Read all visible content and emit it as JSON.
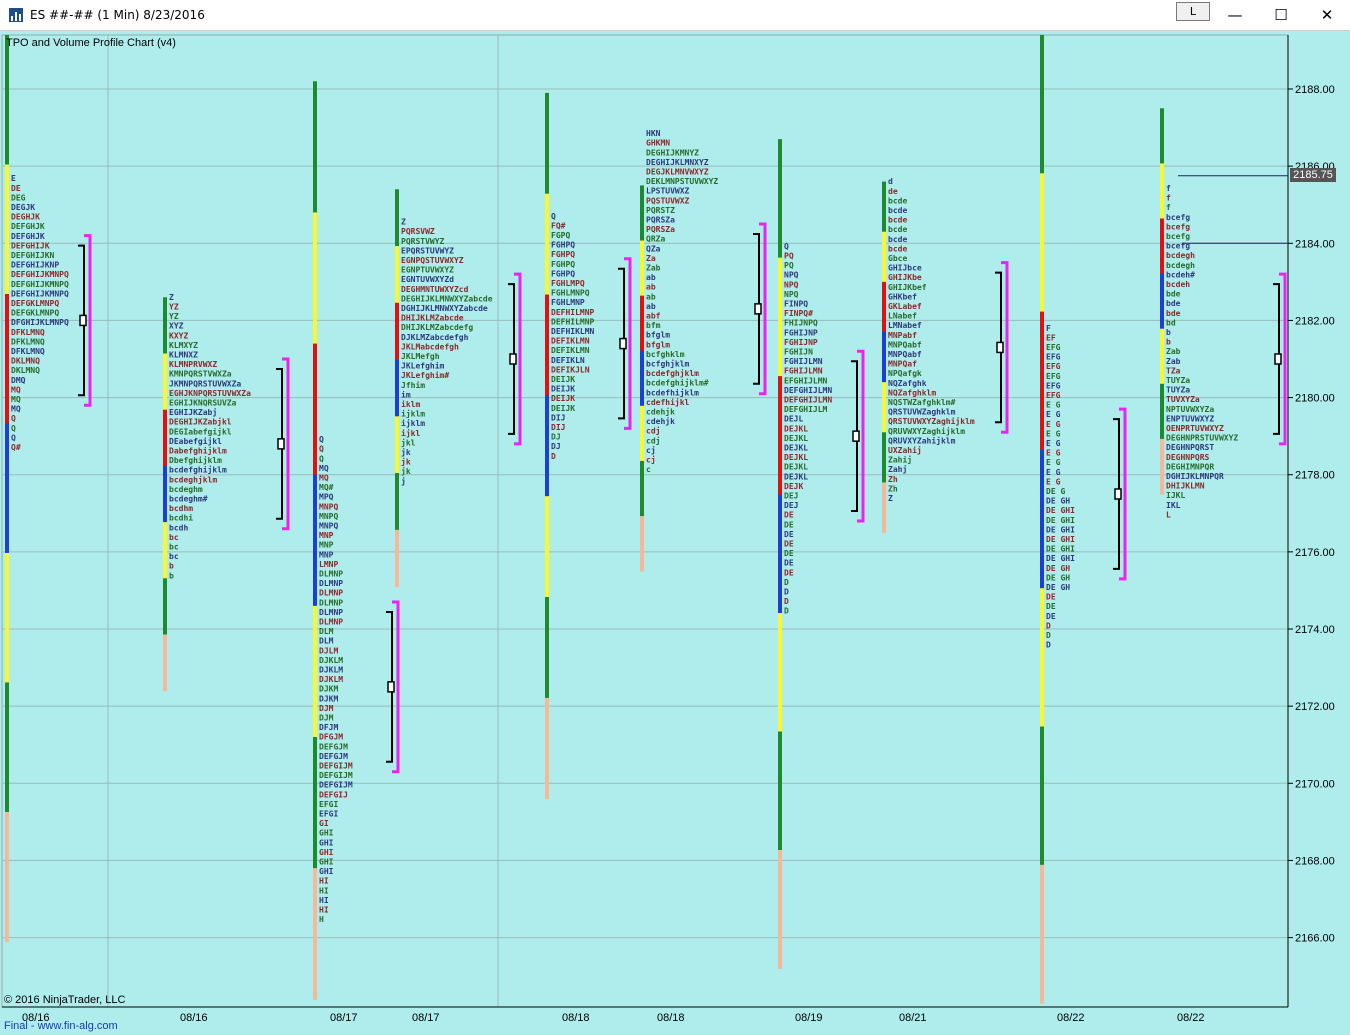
{
  "window": {
    "title": "ES ##-## (1 Min)  8/23/2016",
    "link_label": "L",
    "minimize_glyph": "—",
    "maximize_glyph": "☐",
    "close_glyph": "✕"
  },
  "chart": {
    "title": "TPO and Volume Profile Chart (v4)",
    "copyright": "© 2016 NinjaTrader, LLC",
    "footer_link": "Final - www.fin-alg.com",
    "last_price_label": "2185.75",
    "background_color": "#afecec"
  },
  "chart_data": {
    "type": "tpo-profile",
    "title": "TPO and Volume Profile Chart (v4)",
    "y_ticks": [
      "2188.00",
      "2186.00",
      "2184.00",
      "2182.00",
      "2180.00",
      "2178.00",
      "2176.00",
      "2174.00",
      "2172.00",
      "2170.00",
      "2168.00",
      "2166.00"
    ],
    "y_range": [
      2164.2,
      2189.4
    ],
    "last_price": 2185.75,
    "x_labels": [
      "08/16",
      "08/16",
      "08/17",
      "08/17",
      "08/18",
      "08/18",
      "08/19",
      "08/21",
      "08/22",
      "08/22"
    ],
    "grid": true,
    "profiles": [
      {
        "session": "08/16",
        "high": 2189.4,
        "low": 2165.9,
        "poc": 2182.0,
        "letters": [
          "E",
          "DE",
          "DEG",
          "DEGJK",
          "DEGHJK",
          "DEFGHJK",
          "DEFGHJK",
          "DEFGHIJK",
          "DEFGHIJKN",
          "DEFGHIJKNP",
          "DEFGHIJKMNPQ",
          "DEFGHIJKMNPQ",
          "DEFGHIJKMNPQ",
          "DEFGKLMNPQ",
          "DEFGKLMNPQ",
          "DFGHIJKLMNPQ",
          "DFKLMNQ",
          "DFKLMNQ",
          "DFKLMNQ",
          "DKLMNQ",
          "DKLMNQ",
          "DMQ",
          "MQ",
          "MQ",
          "MQ",
          "Q",
          "Q",
          "Q",
          "Q#"
        ]
      },
      {
        "session": "08/16",
        "high": 2182.6,
        "low": 2172.4,
        "poc": 2178.8,
        "letters": [
          "Z",
          "YZ",
          "YZ",
          "XYZ",
          "KXYZ",
          "KLMXYZ",
          "KLMNXZ",
          "KLMNPRVWXZ",
          "KMNPQRSTVWXZa",
          "JKMNPQRSTUVWXZa",
          "EGHJKNPQRSTUVWXZa",
          "EGHIJKNQRSUVZa",
          "EGHIJKZabj",
          "DEGHIJKZabjkl",
          "DEGIabefgijkl",
          "DEabefgijkl",
          "Dabefghijklm",
          "Dbefghijklm",
          "bcdefghijklm",
          "bcdeghjklm",
          "bcdeghm",
          "bcdeghm#",
          "bcdhm",
          "bcdhi",
          "bcdh",
          "bc",
          "bc",
          "bc",
          "b",
          "b"
        ]
      },
      {
        "session": "08/17",
        "high": 2188.2,
        "low": 2164.4,
        "poc": 2172.5,
        "letters": [
          "Q",
          "Q",
          "Q",
          "MQ",
          "MQ",
          "MQ#",
          "MPQ",
          "MNPQ",
          "MNPQ",
          "MNPQ",
          "MNP",
          "MNP",
          "MNP",
          "LMNP",
          "DLMNP",
          "DLMNP",
          "DLMNP",
          "DLMNP",
          "DLMNP",
          "DLMNP",
          "DLM",
          "DLM",
          "DJLM",
          "DJKLM",
          "DJKLM",
          "DJKLM",
          "DJKM",
          "DJKM",
          "DJM",
          "DJM",
          "DFJM",
          "DFGJM",
          "DEFGJM",
          "DEFGJM",
          "DEFGIJM",
          "DEFGIJM",
          "DEFGIJM",
          "DEFGIJ",
          "EFGI",
          "EFGI",
          "GI",
          "GHI",
          "GHI",
          "GHI",
          "GHI",
          "GHI",
          "HI",
          "HI",
          "HI",
          "HI",
          "H"
        ]
      },
      {
        "session": "08/17",
        "high": 2185.4,
        "low": 2175.1,
        "poc": 2181.0,
        "letters": [
          "Z",
          "PQRSVWZ",
          "PQRSTVWYZ",
          "EPQRSTUVWYZ",
          "EGNPQSTUVWXYZ",
          "EGNPTUVWXYZ",
          "EGNTUVWXYZd",
          "DEGHMNTUWXYZcd",
          "DEGHIJKLMNWXYZabcde",
          "DGHIJKLMNWXYZabcde",
          "DHIJKLMZabcde",
          "DHIJKLMZabcdefg",
          "DJKLMZabcdefgh",
          "JKLMabcdefgh",
          "JKLMefgh",
          "JKLefghim",
          "JKLefghim#",
          "Jfhim",
          "im",
          "iklm",
          "ijklm",
          "ijklm",
          "ijkl",
          "jkl",
          "jk",
          "jk",
          "jk",
          "j"
        ]
      },
      {
        "session": "08/18",
        "high": 2187.9,
        "low": 2169.6,
        "poc": 2181.4,
        "letters": [
          "Q",
          "FQ#",
          "FGPQ",
          "FGHPQ",
          "FGHPQ",
          "FGHPQ",
          "FGHPQ",
          "FGHLMPQ",
          "FGHLMNPQ",
          "FGHLMNP",
          "DEFHILMNP",
          "DEFHILMNP",
          "DEFHIKLMN",
          "DEFIKLMN",
          "DEFIKLMN",
          "DEFIKLN",
          "DEFIKJLN",
          "DEIJK",
          "DEIJK",
          "DEIJK",
          "DEIJK",
          "DIJ",
          "DIJ",
          "DJ",
          "DJ",
          "D"
        ]
      },
      {
        "session": "08/18",
        "high": 2185.5,
        "low": 2175.5,
        "poc": 2182.3,
        "letters": [
          "HKN",
          "GHKMN",
          "DEGHIJKMNYZ",
          "DEGHIJKLMNXYZ",
          "DEGJKLMNVWXYZ",
          "DEKLMNPSTUVWXYZ",
          "LPSTUVWXZ",
          "PQSTUVWXZ",
          "PQRSTZ",
          "PQRSZa",
          "PQRSZa",
          "QRZa",
          "QZa",
          "Za",
          "Zab",
          "ab",
          "ab",
          "ab",
          "ab",
          "abf",
          "bfm",
          "bfglm",
          "bfglm",
          "bcfghklm",
          "bcfghjklm",
          "bcdefghjklm",
          "bcdefghijklm#",
          "bcdefhijklm",
          "cdefhijkl",
          "cdehjk",
          "cdehjk",
          "cdj",
          "cdj",
          "cj",
          "cj",
          "c"
        ]
      },
      {
        "session": "08/19",
        "high": 2186.7,
        "low": 2165.2,
        "poc": 2179.0,
        "letters": [
          "Q",
          "PQ",
          "PQ",
          "NPQ",
          "NPQ",
          "NPQ",
          "FINPQ",
          "FINPQ#",
          "FHIJNPQ",
          "FGHIJNP",
          "FGHIJNP",
          "FGHIJN",
          "FGHIJLMN",
          "FGHIJLMN",
          "EFGHIJLMN",
          "DEFGHIJLMN",
          "DEFGHIJLMN",
          "DEFGHIJLM",
          "DEJL",
          "DEJKL",
          "DEJKL",
          "DEJKL",
          "DEJKL",
          "DEJKL",
          "DEJKL",
          "DEJK",
          "DEJ",
          "DEJ",
          "DE",
          "DE",
          "DE",
          "DE",
          "DE",
          "DE",
          "DE",
          "D",
          "D",
          "D",
          "D"
        ]
      },
      {
        "session": "08/21",
        "high": 2185.6,
        "low": 2176.5,
        "poc": 2181.3,
        "letters": [
          "d",
          "de",
          "bcde",
          "bcde",
          "bcde",
          "bcde",
          "bcde",
          "bcde",
          "Gbce",
          "GHIJbce",
          "GHIJKbe",
          "GHIJKbef",
          "GHKbef",
          "GKLabef",
          "LNabef",
          "LMNabef",
          "MNPabf",
          "MNPQabf",
          "MNPQabf",
          "MNPQaf",
          "NPQafgk",
          "NQZafghk",
          "NQZafghklm",
          "NQSTWZafghklm#",
          "QRSTUVWZaghklm",
          "QRSTUVWXYZaghijklm",
          "QRUVWXYZaghijklm",
          "QRUVXYZahijklm",
          "UXZahij",
          "Zahij",
          "Zahj",
          "Zh",
          "Zh",
          "Z"
        ]
      },
      {
        "session": "08/22",
        "high": 2189.4,
        "low": 2164.3,
        "poc": 2177.5,
        "letters": [
          "F",
          "EF",
          "EFG",
          "EFG",
          "EFG",
          "EFG",
          "EFG",
          "EFG",
          "E G",
          "E G",
          "E G",
          "E G",
          "E G",
          "E G",
          "E G",
          "E G",
          "E G",
          "DE G",
          "DE GH",
          "DE GHI",
          "DE GHI",
          "DE GHI",
          "DE GHI",
          "DE GHI",
          "DE GHI",
          "DE GH",
          "DE GH",
          "DE GH",
          "DE",
          "DE",
          "DE",
          "D",
          "D",
          "D"
        ]
      },
      {
        "session": "08/22",
        "high": 2187.5,
        "low": 2177.5,
        "poc": 2181.0,
        "letters": [
          "f",
          "f",
          "f",
          "bcefg",
          "bcefg",
          "bcefg",
          "bcefg",
          "bcdegh",
          "bcdegh",
          "bcdeh#",
          "bcdeh",
          "bde",
          "bde",
          "bde",
          "bd",
          "b",
          "b",
          "Zab",
          "Zab",
          "TZa",
          "TUYZa",
          "TUYZa",
          "TUVXYZa",
          "NPTUVWXYZa",
          "ENPTUVWXYZ",
          "OENPRTUVWXYZ",
          "DEGHNPRSTUVWXYZ",
          "DEGHNPQRST",
          "DEGHNPQRS",
          "DEGHIMNPQR",
          "DGHIJKLMNPQR",
          "DHIJKLMN",
          "IJKL",
          "IKL",
          "L"
        ]
      }
    ]
  }
}
